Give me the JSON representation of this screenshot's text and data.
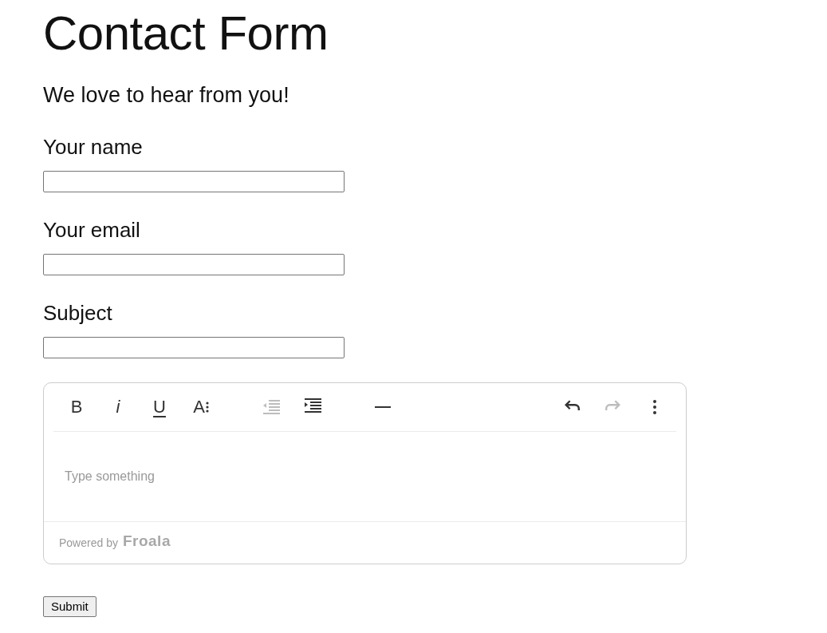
{
  "title": "Contact Form",
  "subtitle": "We love to hear from you!",
  "fields": [
    {
      "label": "Your name"
    },
    {
      "label": "Your email"
    },
    {
      "label": "Subject"
    }
  ],
  "editor": {
    "toolbar_left": [
      {
        "tools": [
          {
            "kind": "bold",
            "label": "B",
            "disabled": false
          },
          {
            "kind": "italic",
            "label": "i",
            "disabled": false
          },
          {
            "kind": "underline",
            "label": "U",
            "disabled": false
          },
          {
            "kind": "font-size",
            "label": "A",
            "disabled": false
          }
        ]
      },
      {
        "tools": [
          {
            "kind": "outdent",
            "disabled": true
          },
          {
            "kind": "indent",
            "disabled": false
          }
        ]
      },
      {
        "tools": [
          {
            "kind": "horizontal-line",
            "disabled": false
          }
        ]
      }
    ],
    "toolbar_right": [
      {
        "tools": [
          {
            "kind": "undo",
            "disabled": false
          },
          {
            "kind": "redo",
            "disabled": true
          },
          {
            "kind": "more",
            "disabled": false
          }
        ]
      }
    ],
    "placeholder": "Type something",
    "footer": {
      "prefix": "Powered by",
      "brand": "Froala"
    }
  },
  "submit": "Submit"
}
